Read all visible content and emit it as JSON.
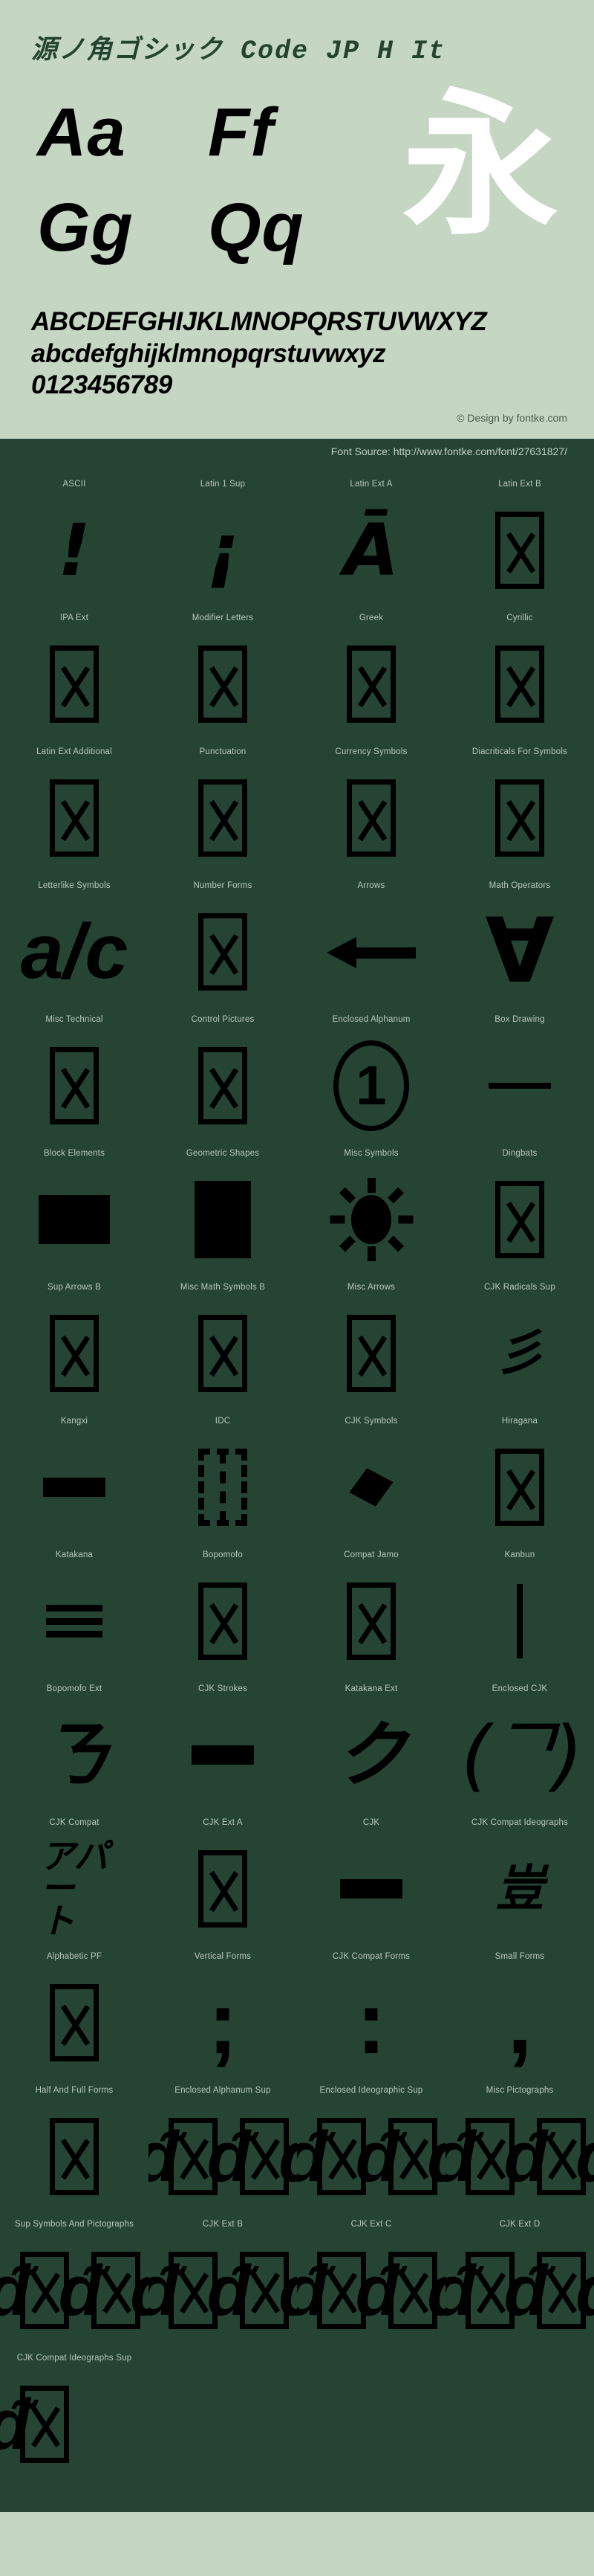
{
  "header": {
    "font_title": "源ノ角ゴシック Code JP H It",
    "samples": [
      [
        "Aa",
        "Ff"
      ],
      [
        "Gg",
        "Qq"
      ]
    ],
    "cjk_sample": "永",
    "alphabet_uppercase": "ABCDEFGHIJKLMNOPQRSTUVWXYZ",
    "alphabet_lowercase": "abcdefghijklmnopqrstuvwxyz",
    "digits": "0123456789",
    "credit": "© Design by fontke.com",
    "font_source": "Font Source: http://www.fontke.com/font/27631827/"
  },
  "colors": {
    "header_bg": "#c5d6c3",
    "dark_bg": "#254434",
    "title_green": "#24442f",
    "label_text": "#b9c8b9",
    "glyph_black": "#000000",
    "cjk_white": "#ffffff"
  },
  "blocks": [
    {
      "label": "ASCII",
      "glyph": "!",
      "kind": "char"
    },
    {
      "label": "Latin 1 Sup",
      "glyph": "¡",
      "kind": "char"
    },
    {
      "label": "Latin Ext A",
      "glyph": "Ā",
      "kind": "char"
    },
    {
      "label": "Latin Ext B",
      "glyph": "",
      "kind": "tofu"
    },
    {
      "label": "IPA Ext",
      "glyph": "",
      "kind": "tofu"
    },
    {
      "label": "Modifier Letters",
      "glyph": "",
      "kind": "tofu"
    },
    {
      "label": "Greek",
      "glyph": "",
      "kind": "tofu"
    },
    {
      "label": "Cyrillic",
      "glyph": "",
      "kind": "tofu"
    },
    {
      "label": "Latin Ext Additional",
      "glyph": "",
      "kind": "tofu"
    },
    {
      "label": "Punctuation",
      "glyph": "",
      "kind": "tofu"
    },
    {
      "label": "Currency Symbols",
      "glyph": "",
      "kind": "tofu"
    },
    {
      "label": "Diacriticals For Symbols",
      "glyph": "",
      "kind": "tofu"
    },
    {
      "label": "Letterlike Symbols",
      "glyph": "a/c",
      "kind": "percent"
    },
    {
      "label": "Number Forms",
      "glyph": "",
      "kind": "tofu"
    },
    {
      "label": "Arrows",
      "glyph": "←",
      "kind": "arrow-left"
    },
    {
      "label": "Math Operators",
      "glyph": "∀",
      "kind": "forall"
    },
    {
      "label": "Misc Technical",
      "glyph": "",
      "kind": "tofu"
    },
    {
      "label": "Control Pictures",
      "glyph": "",
      "kind": "tofu"
    },
    {
      "label": "Enclosed Alphanum",
      "glyph": "1",
      "kind": "circled"
    },
    {
      "label": "Box Drawing",
      "glyph": "─",
      "kind": "bar-h"
    },
    {
      "label": "Block Elements",
      "glyph": "▀",
      "kind": "solid-wide"
    },
    {
      "label": "Geometric Shapes",
      "glyph": "■",
      "kind": "solid-tall"
    },
    {
      "label": "Misc Symbols",
      "glyph": "☀",
      "kind": "sun"
    },
    {
      "label": "Dingbats",
      "glyph": "",
      "kind": "tofu"
    },
    {
      "label": "Sup Arrows B",
      "glyph": "",
      "kind": "tofu"
    },
    {
      "label": "Misc Math Symbols B",
      "glyph": "",
      "kind": "tofu"
    },
    {
      "label": "Misc Arrows",
      "glyph": "",
      "kind": "tofu"
    },
    {
      "label": "CJK Radicals Sup",
      "glyph": "彡",
      "kind": "char-small"
    },
    {
      "label": "Kangxi",
      "glyph": "⼀",
      "kind": "bar-h-thick"
    },
    {
      "label": "IDC",
      "glyph": "⿰",
      "kind": "tofu-dashed"
    },
    {
      "label": "CJK Symbols",
      "glyph": "丶",
      "kind": "diamond"
    },
    {
      "label": "Hiragana",
      "glyph": "",
      "kind": "tofu"
    },
    {
      "label": "Katakana",
      "glyph": "≡",
      "kind": "equals"
    },
    {
      "label": "Bopomofo",
      "glyph": "",
      "kind": "tofu"
    },
    {
      "label": "Compat Jamo",
      "glyph": "",
      "kind": "tofu"
    },
    {
      "label": "Kanbun",
      "glyph": "丨",
      "kind": "bar-v"
    },
    {
      "label": "Bopomofo Ext",
      "glyph": "ㄋ",
      "kind": "char"
    },
    {
      "label": "CJK Strokes",
      "glyph": "㇐",
      "kind": "bar-h-thick"
    },
    {
      "label": "Katakana Ext",
      "glyph": "ク",
      "kind": "char"
    },
    {
      "label": "Enclosed CJK",
      "glyph": "㈀",
      "kind": "paren"
    },
    {
      "label": "CJK Compat",
      "glyph": "アパート",
      "kind": "stacked"
    },
    {
      "label": "CJK Ext A",
      "glyph": "",
      "kind": "tofu"
    },
    {
      "label": "CJK",
      "glyph": "一",
      "kind": "bar-h-thick"
    },
    {
      "label": "CJK Compat Ideographs",
      "glyph": "豈",
      "kind": "char-small"
    },
    {
      "label": "Alphabetic PF",
      "glyph": "",
      "kind": "tofu"
    },
    {
      "label": "Vertical Forms",
      "glyph": "︔",
      "kind": "semicolon"
    },
    {
      "label": "CJK Compat Forms",
      "glyph": "︓",
      "kind": "colon"
    },
    {
      "label": "Small Forms",
      "glyph": "﹐",
      "kind": "comma"
    },
    {
      "label": "Half And Full Forms",
      "glyph": "",
      "kind": "tofu"
    },
    {
      "label": "Enclosed Alphanum Sup",
      "glyph": "",
      "kind": "cluster"
    },
    {
      "label": "Enclosed Ideographic Sup",
      "glyph": "",
      "kind": "cluster"
    },
    {
      "label": "Misc Pictographs",
      "glyph": "",
      "kind": "cluster"
    },
    {
      "label": "Sup Symbols And Pictographs",
      "glyph": "",
      "kind": "cluster"
    },
    {
      "label": "CJK Ext B",
      "glyph": "",
      "kind": "cluster"
    },
    {
      "label": "CJK Ext C",
      "glyph": "",
      "kind": "cluster"
    },
    {
      "label": "CJK Ext D",
      "glyph": "",
      "kind": "cluster"
    },
    {
      "label": "CJK Compat Ideographs Sup",
      "glyph": "",
      "kind": "cluster-last"
    }
  ]
}
